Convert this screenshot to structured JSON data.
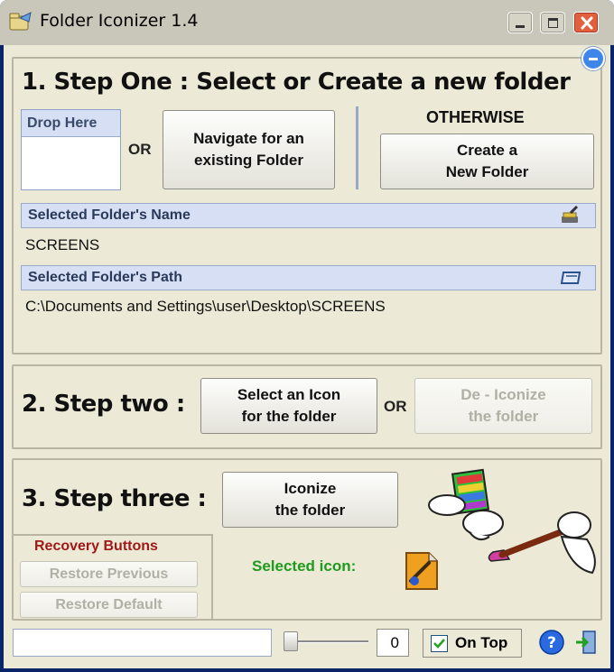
{
  "window": {
    "title": "Folder Iconizer 1.4"
  },
  "step1": {
    "heading": "1. Step One : Select or Create a new folder",
    "drop_label": "Drop Here",
    "or_label": "OR",
    "navigate_button": "Navigate for an\nexisting Folder",
    "otherwise_label": "OTHERWISE",
    "create_button": "Create a\nNew Folder",
    "name_header": "Selected Folder's Name",
    "name_value": "SCREENS",
    "path_header": "Selected Folder's Path",
    "path_value": "C:\\Documents and Settings\\user\\Desktop\\SCREENS"
  },
  "step2": {
    "heading": "2. Step two :",
    "select_icon_button": "Select an Icon\nfor the folder",
    "or_label": "OR",
    "deiconize_button": "De - Iconize\nthe folder"
  },
  "step3": {
    "heading": "3. Step three :",
    "iconize_button": "Iconize\nthe folder",
    "selected_icon_label": "Selected icon:"
  },
  "recovery": {
    "title": "Recovery Buttons",
    "restore_previous": "Restore Previous",
    "restore_default": "Restore Default"
  },
  "statusbar": {
    "status_text": "",
    "slider_value": 0,
    "number_value": "0",
    "ontop_label": "On Top",
    "ontop_checked": true
  },
  "colors": {
    "client_bg": "#ecead6",
    "header_bar": "#d6dff3",
    "recovery_title": "#a01818",
    "selected_icon_label": "#1e9a1e",
    "disabled_text": "#b1b0a4"
  },
  "icons": [
    "app-icon",
    "minimize-icon",
    "maximize-icon",
    "close-icon",
    "collapse-icon",
    "rename-brush-icon",
    "folder-path-icon",
    "rainbow-folder-glove-icon",
    "paintbrush-glove-icon",
    "selected-folder-icon",
    "help-icon",
    "exit-icon"
  ]
}
